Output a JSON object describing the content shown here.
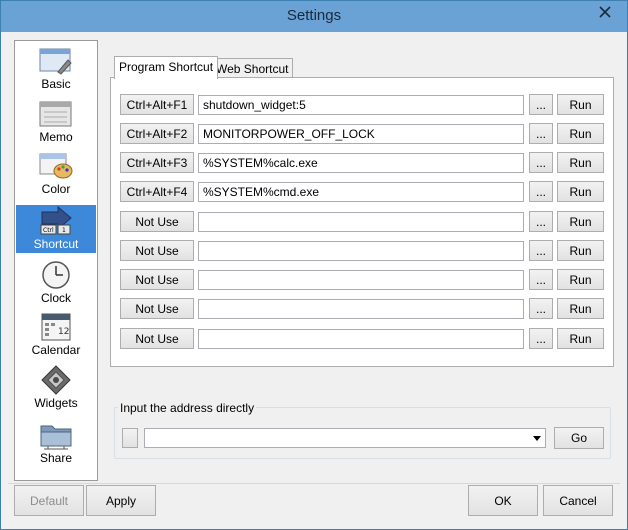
{
  "window": {
    "title": "Settings"
  },
  "sidebar": {
    "items": [
      {
        "label": "Basic",
        "icon": "basic-settings-icon",
        "active": false
      },
      {
        "label": "Memo",
        "icon": "memo-icon",
        "active": false
      },
      {
        "label": "Color",
        "icon": "palette-icon",
        "active": false
      },
      {
        "label": "Shortcut",
        "icon": "shortcut-key-icon",
        "active": true
      },
      {
        "label": "Clock",
        "icon": "clock-icon",
        "active": false
      },
      {
        "label": "Calendar",
        "icon": "calendar-icon",
        "active": false
      },
      {
        "label": "Widgets",
        "icon": "widgets-icon",
        "active": false
      },
      {
        "label": "Share",
        "icon": "folder-share-icon",
        "active": false
      }
    ]
  },
  "tabs": [
    {
      "label": "Program Shortcut",
      "active": true
    },
    {
      "label": "Web Shortcut",
      "active": false
    }
  ],
  "shortcuts": [
    {
      "key": "Ctrl+Alt+F1",
      "path": "shutdown_widget:5",
      "browse": "...",
      "run": "Run"
    },
    {
      "key": "Ctrl+Alt+F2",
      "path": "MONITORPOWER_OFF_LOCK",
      "browse": "...",
      "run": "Run"
    },
    {
      "key": "Ctrl+Alt+F3",
      "path": "%SYSTEM%calc.exe",
      "browse": "...",
      "run": "Run"
    },
    {
      "key": "Ctrl+Alt+F4",
      "path": "%SYSTEM%cmd.exe",
      "browse": "...",
      "run": "Run"
    },
    {
      "key": "Not Use",
      "path": "",
      "browse": "...",
      "run": "Run"
    },
    {
      "key": "Not Use",
      "path": "",
      "browse": "...",
      "run": "Run"
    },
    {
      "key": "Not Use",
      "path": "",
      "browse": "...",
      "run": "Run"
    },
    {
      "key": "Not Use",
      "path": "",
      "browse": "...",
      "run": "Run"
    },
    {
      "key": "Not Use",
      "path": "",
      "browse": "...",
      "run": "Run"
    }
  ],
  "address": {
    "legend": "Input the address directly",
    "value": "",
    "go": "Go"
  },
  "footer": {
    "default": "Default",
    "apply": "Apply",
    "ok": "OK",
    "cancel": "Cancel"
  },
  "colors": {
    "titlebar": "#6aa2d6",
    "active_nav": "#3d88d8",
    "window_bg": "#f0f0f0"
  }
}
